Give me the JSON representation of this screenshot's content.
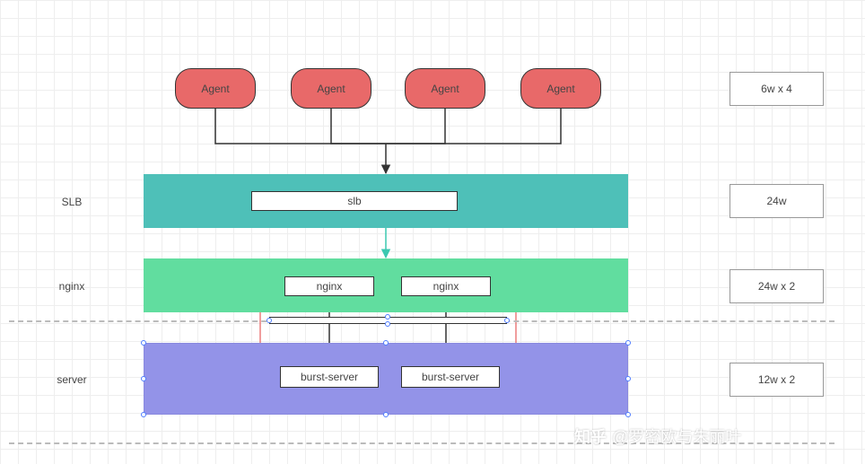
{
  "agents": {
    "label": "Agent",
    "count": 4
  },
  "layers": {
    "slb": {
      "side_label": "SLB",
      "box_label": "slb"
    },
    "nginx": {
      "side_label": "nginx",
      "box_label": "nginx"
    },
    "server": {
      "side_label": "server",
      "box_label": "burst-server"
    }
  },
  "annotations": {
    "agents": "6w x 4",
    "slb": "24w",
    "nginx": "24w x 2",
    "server": "12w x 2"
  },
  "watermark": {
    "brand": "知乎",
    "at": "@罗密欧与朱丽叶"
  },
  "colors": {
    "agent_fill": "#e86969",
    "slb_fill": "#4ec0b8",
    "nginx_fill": "#61dd9f",
    "server_fill": "#9393e8",
    "arrow_black": "#333333",
    "arrow_teal": "#3bc8b0",
    "arrow_red": "#e86969"
  },
  "chart_data": {
    "type": "diagram",
    "title": "",
    "nodes": [
      {
        "id": "agent1",
        "label": "Agent",
        "layer": "agents"
      },
      {
        "id": "agent2",
        "label": "Agent",
        "layer": "agents"
      },
      {
        "id": "agent3",
        "label": "Agent",
        "layer": "agents"
      },
      {
        "id": "agent4",
        "label": "Agent",
        "layer": "agents"
      },
      {
        "id": "slb",
        "label": "slb",
        "layer": "SLB"
      },
      {
        "id": "nginx1",
        "label": "nginx",
        "layer": "nginx"
      },
      {
        "id": "nginx2",
        "label": "nginx",
        "layer": "nginx"
      },
      {
        "id": "burst1",
        "label": "burst-server",
        "layer": "server"
      },
      {
        "id": "burst2",
        "label": "burst-server",
        "layer": "server"
      }
    ],
    "edges": [
      {
        "from": "agent1",
        "to": "slb",
        "color": "black"
      },
      {
        "from": "agent2",
        "to": "slb",
        "color": "black"
      },
      {
        "from": "agent3",
        "to": "slb",
        "color": "black"
      },
      {
        "from": "agent4",
        "to": "slb",
        "color": "black"
      },
      {
        "from": "slb",
        "to": "nginx1",
        "color": "teal"
      },
      {
        "from": "slb",
        "to": "nginx2",
        "color": "teal"
      },
      {
        "from": "nginx1",
        "to": "burst1",
        "color": "black"
      },
      {
        "from": "nginx2",
        "to": "burst2",
        "color": "black"
      },
      {
        "from": "nginx1",
        "to": "burst2",
        "color": "red"
      },
      {
        "from": "nginx2",
        "to": "burst1",
        "color": "red"
      }
    ],
    "layer_annotations": {
      "agents": "6w x 4",
      "SLB": "24w",
      "nginx": "24w x 2",
      "server": "12w x 2"
    }
  }
}
